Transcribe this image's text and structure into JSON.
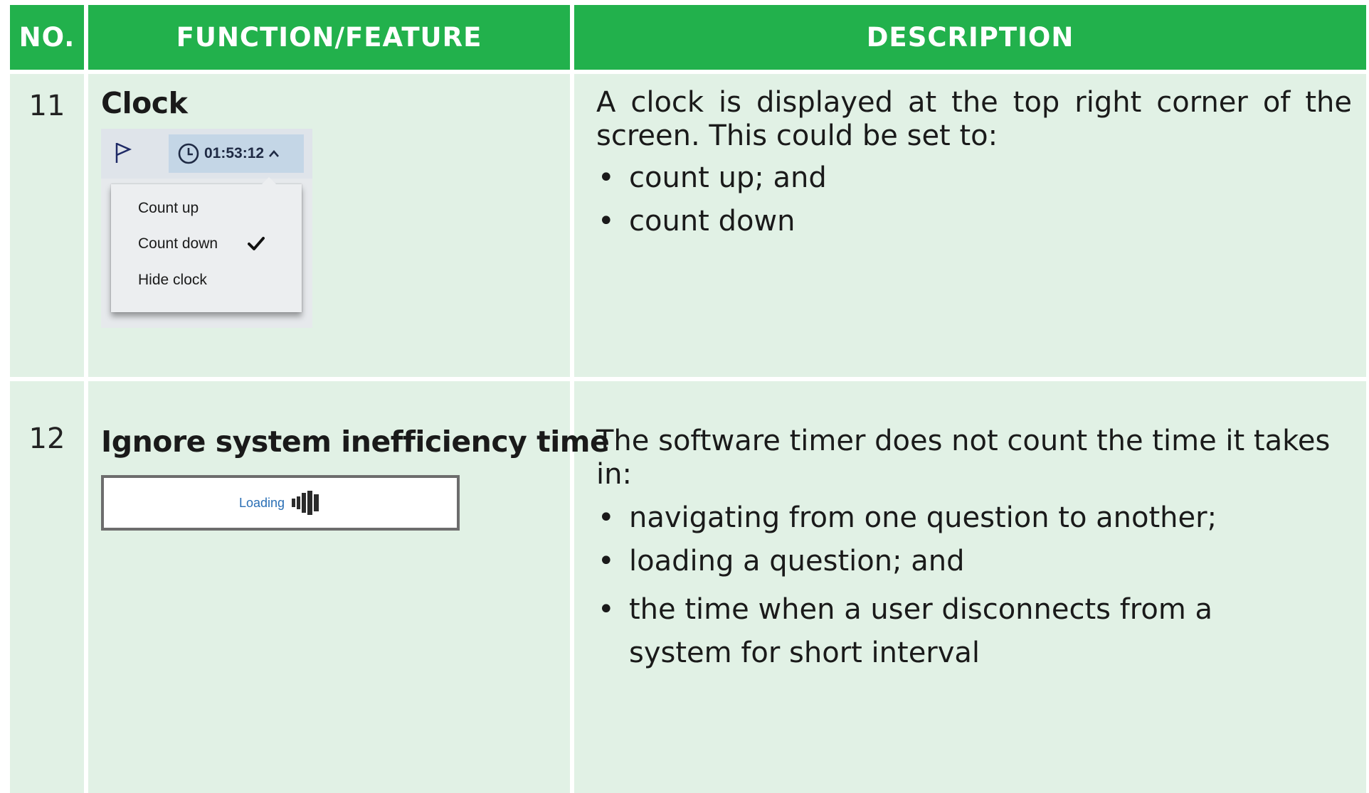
{
  "header": {
    "no": "NO.",
    "function": "FUNCTION/FEATURE",
    "description": "DESCRIPTION"
  },
  "rows": [
    {
      "no": "11",
      "feature": "Clock",
      "description_intro": "A clock is displayed at the top right corner of the screen. This could be set to:",
      "bullets": [
        "count up; and",
        "count down"
      ],
      "widget": {
        "time": "01:53:12",
        "menu_items": [
          "Count up",
          "Count down",
          "Hide clock"
        ],
        "checked_item": "Count down"
      }
    },
    {
      "no": "12",
      "feature": "Ignore system inefficiency time",
      "description_intro": "The software timer does not count the time it takes in:",
      "bullets": [
        "navigating from one question to another;",
        "loading a question; and",
        "the time when a user disconnects from a system for short interval"
      ],
      "widget": {
        "loading_label": "Loading"
      }
    }
  ],
  "icons": {
    "flag": "flag-icon",
    "clock": "clock-icon",
    "caret": "chevron-up-icon",
    "check": "check-icon",
    "loading": "loading-bars-icon"
  },
  "colors": {
    "header_green": "#22b14c",
    "row_bg": "#e1f1e5"
  }
}
